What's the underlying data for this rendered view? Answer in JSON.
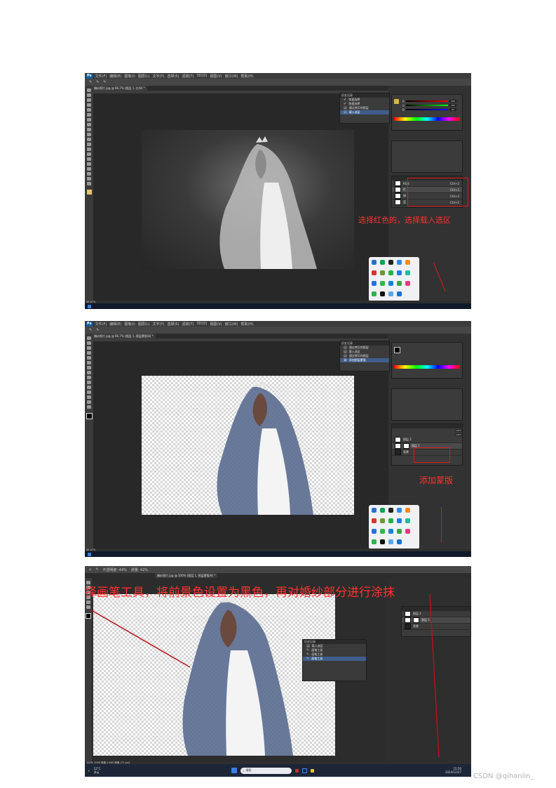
{
  "screenshot1": {
    "menu": [
      "文件(F)",
      "编辑(E)",
      "图像(I)",
      "图层(L)",
      "文字(Y)",
      "选择(S)",
      "滤镜(T)",
      "3D(D)",
      "视图(V)",
      "窗口(W)",
      "帮助(H)"
    ],
    "tab_title": "婚纱照片.jpg @ 66.7% (图层 1, 红/8) *",
    "history_title": "历史记录",
    "history": [
      "快速选择",
      "快速选择",
      "通过拷贝的图层",
      "载入选区"
    ],
    "history_selected": 3,
    "channels": [
      {
        "name": "RGB",
        "shortcut": "Ctrl+2"
      },
      {
        "name": "红",
        "shortcut": "Ctrl+3"
      },
      {
        "name": "绿",
        "shortcut": "Ctrl+4"
      },
      {
        "name": "蓝",
        "shortcut": "Ctrl+5"
      }
    ],
    "color_values": [
      "206",
      "182",
      "83"
    ],
    "annotation": "选择红色的，选择载入选区",
    "zoom": "66.67%"
  },
  "screenshot2": {
    "tab_title": "婚纱照片.jpg @ 66.7% (图层 1, 图层蒙版/8) *",
    "history": [
      "通过拷贝的图层",
      "载入选区",
      "通过拷贝的图层",
      "添加图层蒙版"
    ],
    "history_selected": 3,
    "opacity": "100%",
    "fill": "100%",
    "layers": [
      "图层 2",
      "图层 1",
      "背景"
    ],
    "annotation": "添加蒙版",
    "zoom": "66.67%"
  },
  "screenshot3": {
    "tab_title": "婚纱照片.jpg @ 100% (图层 1, 图层蒙版/8) *",
    "opacity_label": "不透明度: 44%",
    "flow_label": "流量: 42%",
    "history_title": "历史记录",
    "history": [
      "载入选区",
      "画笔工具",
      "画笔工具",
      "画笔工具"
    ],
    "history_selected": 3,
    "layers": [
      "图层 2",
      "图层 1",
      "背景"
    ],
    "annotation": "择画笔工具，将前景色设置为黑色，再对婚纱部分进行涂抹",
    "status": "100%    1000 像素 x 665 像素 (72 ppi)",
    "weather": "12°C",
    "weather_desc": "多云",
    "search": "搜索",
    "clock_time": "15:50",
    "clock_date": "2024/12/27"
  },
  "watermark": "CSDN @qihanlin_",
  "colors": {
    "accent_red": "#e0191d",
    "ps_dark": "#2b2b2b",
    "selected_blue": "#3f5e8c"
  }
}
